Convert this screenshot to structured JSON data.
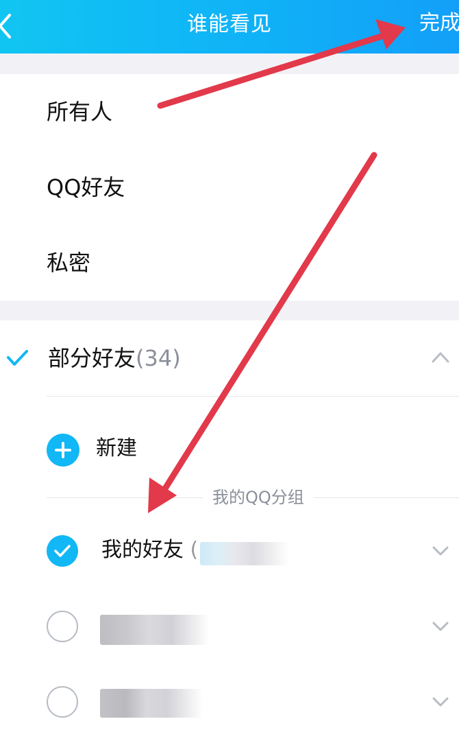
{
  "header": {
    "title": "谁能看见",
    "done_label": "完成"
  },
  "options": [
    {
      "label": "所有人",
      "selected": false
    },
    {
      "label": "QQ好友",
      "selected": false
    },
    {
      "label": "私密",
      "selected": false
    }
  ],
  "partial": {
    "label": "部分好友",
    "count": "(34)",
    "selected": true
  },
  "new_group": {
    "label": "新建"
  },
  "section_label": "我的QQ分组",
  "groups": [
    {
      "label": "我的好友",
      "count_prefix": "(",
      "checked": true
    },
    {
      "label": "",
      "checked": false
    },
    {
      "label": "",
      "checked": false
    }
  ],
  "colors": {
    "accent": "#12b7f5",
    "header_start": "#11c5f2",
    "header_end": "#139ff8",
    "annotation_arrow": "#e2394b"
  }
}
